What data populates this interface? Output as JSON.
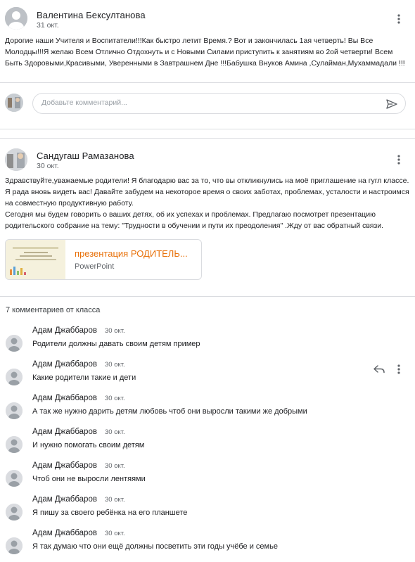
{
  "posts": [
    {
      "author": "Валентина Бексултанова",
      "date": "31 окт.",
      "body": "Дорогие наши Учителя и Воспитатели!!!Как быстро летит Время.? Вот и закончилась 1ая четверть! Вы Все Молодцы!!!Я желаю Всем Отлично Отдохнуть и с Новыми Силами приступить к занятиям во 2ой четверти! Всем Быть Здоровыми,Красивыми, Уверенными в Завтрашнем Дне !!!Бабушка Внуков Амина ,Сулайман,Мухаммадали !!!"
    },
    {
      "author": "Сандугаш Рамазанова",
      "date": "30 окт.",
      "body": "Здравствуйте,уважаемые родители! Я благодарю вас за то, что вы откликнулись на моё приглашение на гугл классе. Я рада вновь видеть вас! Давайте забудем на некоторое время о своих заботах, проблемах, усталости и настроимся на совместную продуктивную работу.\nСегодня мы будем говорить о ваших детях, об их успехах и проблемах. Предлагаю посмотрет презентацию родительского собрание на тему: \"Трудности в обучении и пути их преодоления\" .Жду от вас обратный связи.",
      "attachment": {
        "title": "презентация РОДИТЕЛЬ...",
        "type": "PowerPoint"
      }
    }
  ],
  "reply": {
    "placeholder": "Добавьте комментарий..."
  },
  "comments_header": "7 комментариев от класса",
  "comments": [
    {
      "author": "Адам Джаббаров",
      "date": "30 окт.",
      "text": "Родители должны давать своим детям пример"
    },
    {
      "author": "Адам Джаббаров",
      "date": "30 окт.",
      "text": "Какие родители такие и дети"
    },
    {
      "author": "Адам Джаббаров",
      "date": "30 окт.",
      "text": "А так же нужно дарить детям любовь чтоб они выросли такими же добрыми"
    },
    {
      "author": "Адам Джаббаров",
      "date": "30 окт.",
      "text": "И нужно помогать своим детям"
    },
    {
      "author": "Адам Джаббаров",
      "date": "30 окт.",
      "text": "Чтоб они не выросли лентяями"
    },
    {
      "author": "Адам Джаббаров",
      "date": "30 окт.",
      "text": "Я пишу за своего ребёнка на его планшете"
    },
    {
      "author": "Адам Джаббаров",
      "date": "30 окт.",
      "text": "Я так думаю что они ещё должны посветить эти годы учёбе и семье"
    }
  ],
  "icons": {
    "more": "more-vert-icon",
    "send": "send-icon",
    "reply": "reply-icon",
    "avatar": "person-avatar"
  },
  "colors": {
    "accent_orange": "#e8710a",
    "divider": "#dadce0",
    "secondary_text": "#5f6368"
  }
}
